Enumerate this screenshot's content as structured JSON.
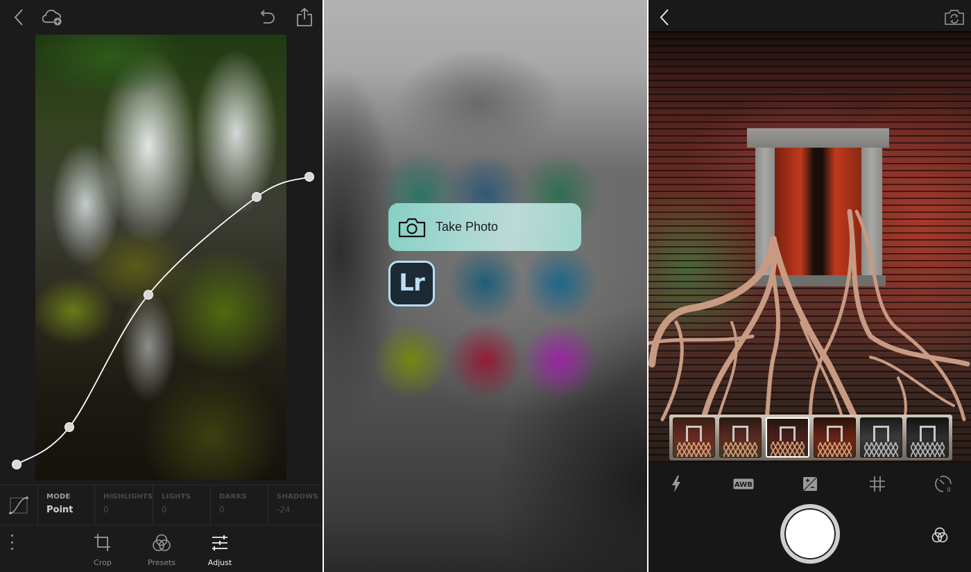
{
  "editor": {
    "topbar": {
      "back_icon": "chevron-left-icon",
      "cloud_icon": "cloud-add-icon",
      "undo_icon": "undo-icon",
      "share_icon": "share-icon"
    },
    "curve": {
      "points": [
        [
          0.0,
          0.0
        ],
        [
          0.18,
          0.13
        ],
        [
          0.45,
          0.59
        ],
        [
          0.82,
          0.93
        ],
        [
          1.0,
          1.0
        ]
      ],
      "color": "#ffffff"
    },
    "tone_panel": {
      "icon": "tone-curve-icon",
      "mode": {
        "label": "MODE",
        "value": "Point"
      },
      "regions": [
        {
          "label": "HIGHLIGHTS",
          "value": "0"
        },
        {
          "label": "LIGHTS",
          "value": "0"
        },
        {
          "label": "DARKS",
          "value": "0"
        },
        {
          "label": "SHADOWS",
          "value": "-24"
        }
      ]
    },
    "bottom_nav": {
      "more_icon": "more-vertical-icon",
      "items": [
        {
          "label": "Crop",
          "icon": "crop-icon",
          "active": false
        },
        {
          "label": "Presets",
          "icon": "presets-icon",
          "active": false
        },
        {
          "label": "Adjust",
          "icon": "sliders-icon",
          "active": true
        }
      ]
    }
  },
  "home_screen": {
    "quick_action": {
      "label": "Take Photo",
      "icon": "camera-icon"
    },
    "app_icon": {
      "text": "Lr",
      "name": "Lightroom",
      "bg": "#1c2a36",
      "fg": "#b9def4"
    },
    "blurred_app_colors": [
      "#14786a",
      "#145078",
      "#146e46",
      "#0f5a78",
      "#0f648c",
      "#788c0a",
      "#961432",
      "#a01eaa"
    ]
  },
  "camera": {
    "topbar": {
      "back_icon": "chevron-left-icon",
      "switch_camera_icon": "camera-flip-icon"
    },
    "filter_thumbnails": [
      {
        "name": "filter-1",
        "selected": false,
        "style": "color"
      },
      {
        "name": "filter-2",
        "selected": false,
        "style": "color"
      },
      {
        "name": "filter-3",
        "selected": true,
        "style": "color"
      },
      {
        "name": "filter-4",
        "selected": false,
        "style": "warm"
      },
      {
        "name": "filter-5",
        "selected": false,
        "style": "bw"
      },
      {
        "name": "filter-6",
        "selected": false,
        "style": "bw"
      }
    ],
    "tools": [
      {
        "name": "flash",
        "icon": "flash-icon"
      },
      {
        "name": "white-balance",
        "icon": "awb-icon",
        "label": "AWB"
      },
      {
        "name": "exposure",
        "icon": "exposure-icon"
      },
      {
        "name": "grid",
        "icon": "grid-icon"
      },
      {
        "name": "timer",
        "icon": "timer-icon",
        "value": "0"
      }
    ],
    "shutter_icon": "shutter-icon",
    "presets_icon": "presets-icon"
  }
}
